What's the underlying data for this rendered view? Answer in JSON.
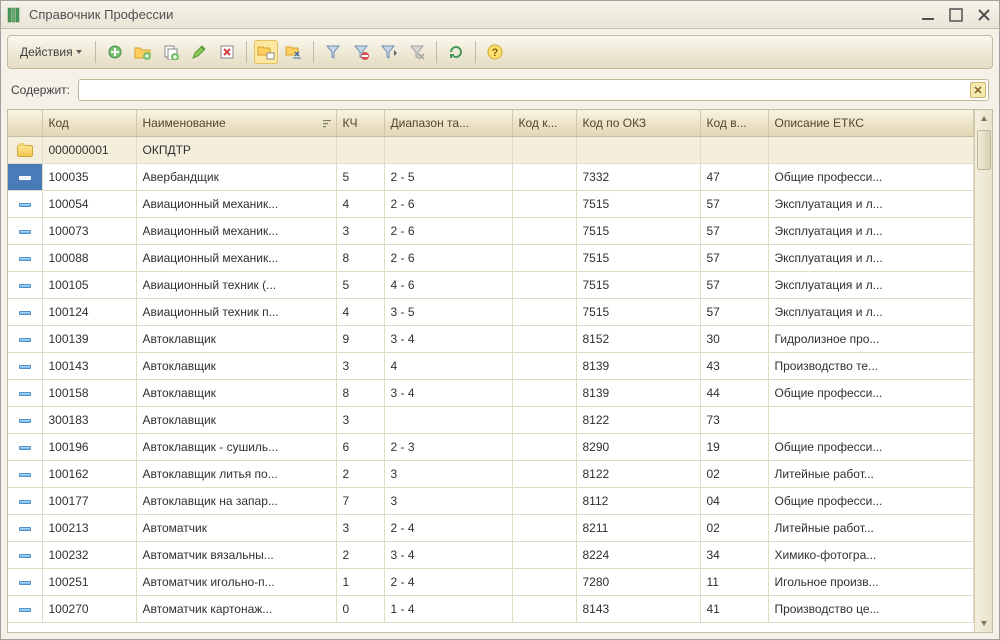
{
  "window": {
    "title": "Справочник Профессии"
  },
  "toolbar": {
    "actions_label": "Действия"
  },
  "filter": {
    "label": "Содержит:",
    "value": "",
    "placeholder": ""
  },
  "columns": {
    "icon": "",
    "code": "Код",
    "name": "Наименование",
    "kch": "КЧ",
    "range": "Диапазон та...",
    "code_k": "Код к...",
    "code_okz": "Код по ОКЗ",
    "code_v": "Код в...",
    "etks": "Описание ЕТКС"
  },
  "rows": [
    {
      "type": "folder",
      "code": "000000001",
      "name": "ОКПДТР",
      "kch": "",
      "range": "",
      "code_k": "",
      "code_okz": "",
      "code_v": "",
      "etks": ""
    },
    {
      "type": "item",
      "selected": true,
      "code": "100035",
      "name": "Авербандщик",
      "kch": "5",
      "range": "2 - 5",
      "code_k": "",
      "code_okz": "7332",
      "code_v": "47",
      "etks": "Общие професси..."
    },
    {
      "type": "item",
      "code": "100054",
      "name": "Авиационный механик...",
      "kch": "4",
      "range": "2 - 6",
      "code_k": "",
      "code_okz": "7515",
      "code_v": "57",
      "etks": "Эксплуатация и л..."
    },
    {
      "type": "item",
      "code": "100073",
      "name": "Авиационный механик...",
      "kch": "3",
      "range": "2 - 6",
      "code_k": "",
      "code_okz": "7515",
      "code_v": "57",
      "etks": "Эксплуатация и л..."
    },
    {
      "type": "item",
      "code": "100088",
      "name": "Авиационный механик...",
      "kch": "8",
      "range": "2 - 6",
      "code_k": "",
      "code_okz": "7515",
      "code_v": "57",
      "etks": "Эксплуатация и л..."
    },
    {
      "type": "item",
      "code": "100105",
      "name": "Авиационный техник (...",
      "kch": "5",
      "range": "4 - 6",
      "code_k": "",
      "code_okz": "7515",
      "code_v": "57",
      "etks": "Эксплуатация и л..."
    },
    {
      "type": "item",
      "code": "100124",
      "name": "Авиационный техник п...",
      "kch": "4",
      "range": "3 - 5",
      "code_k": "",
      "code_okz": "7515",
      "code_v": "57",
      "etks": "Эксплуатация и л..."
    },
    {
      "type": "item",
      "code": "100139",
      "name": "Автоклавщик",
      "kch": "9",
      "range": "3 - 4",
      "code_k": "",
      "code_okz": "8152",
      "code_v": "30",
      "etks": "Гидролизное про..."
    },
    {
      "type": "item",
      "code": "100143",
      "name": "Автоклавщик",
      "kch": "3",
      "range": "4",
      "code_k": "",
      "code_okz": "8139",
      "code_v": "43",
      "etks": "Производство те..."
    },
    {
      "type": "item",
      "code": "100158",
      "name": "Автоклавщик",
      "kch": "8",
      "range": "3 - 4",
      "code_k": "",
      "code_okz": "8139",
      "code_v": "44",
      "etks": "Общие професси..."
    },
    {
      "type": "item",
      "code": "300183",
      "name": "Автоклавщик",
      "kch": "3",
      "range": "",
      "code_k": "",
      "code_okz": "8122",
      "code_v": "73",
      "etks": ""
    },
    {
      "type": "item",
      "code": "100196",
      "name": "Автоклавщик - сушиль...",
      "kch": "6",
      "range": "2 - 3",
      "code_k": "",
      "code_okz": "8290",
      "code_v": "19",
      "etks": "Общие професси..."
    },
    {
      "type": "item",
      "code": "100162",
      "name": "Автоклавщик литья по...",
      "kch": "2",
      "range": "3",
      "code_k": "",
      "code_okz": "8122",
      "code_v": "02",
      "etks": "Литейные работ..."
    },
    {
      "type": "item",
      "code": "100177",
      "name": "Автоклавщик на запар...",
      "kch": "7",
      "range": "3",
      "code_k": "",
      "code_okz": "8112",
      "code_v": "04",
      "etks": "Общие професси..."
    },
    {
      "type": "item",
      "code": "100213",
      "name": "Автоматчик",
      "kch": "3",
      "range": "2 - 4",
      "code_k": "",
      "code_okz": "8211",
      "code_v": "02",
      "etks": "Литейные работ..."
    },
    {
      "type": "item",
      "code": "100232",
      "name": "Автоматчик вязальны...",
      "kch": "2",
      "range": "3 - 4",
      "code_k": "",
      "code_okz": "8224",
      "code_v": "34",
      "etks": "Химико-фотогра..."
    },
    {
      "type": "item",
      "code": "100251",
      "name": "Автоматчик игольно-п...",
      "kch": "1",
      "range": "2 - 4",
      "code_k": "",
      "code_okz": "7280",
      "code_v": "11",
      "etks": "Игольное произв..."
    },
    {
      "type": "item",
      "code": "100270",
      "name": "Автоматчик картонаж...",
      "kch": "0",
      "range": "1 - 4",
      "code_k": "",
      "code_okz": "8143",
      "code_v": "41",
      "etks": "Производство це..."
    }
  ]
}
